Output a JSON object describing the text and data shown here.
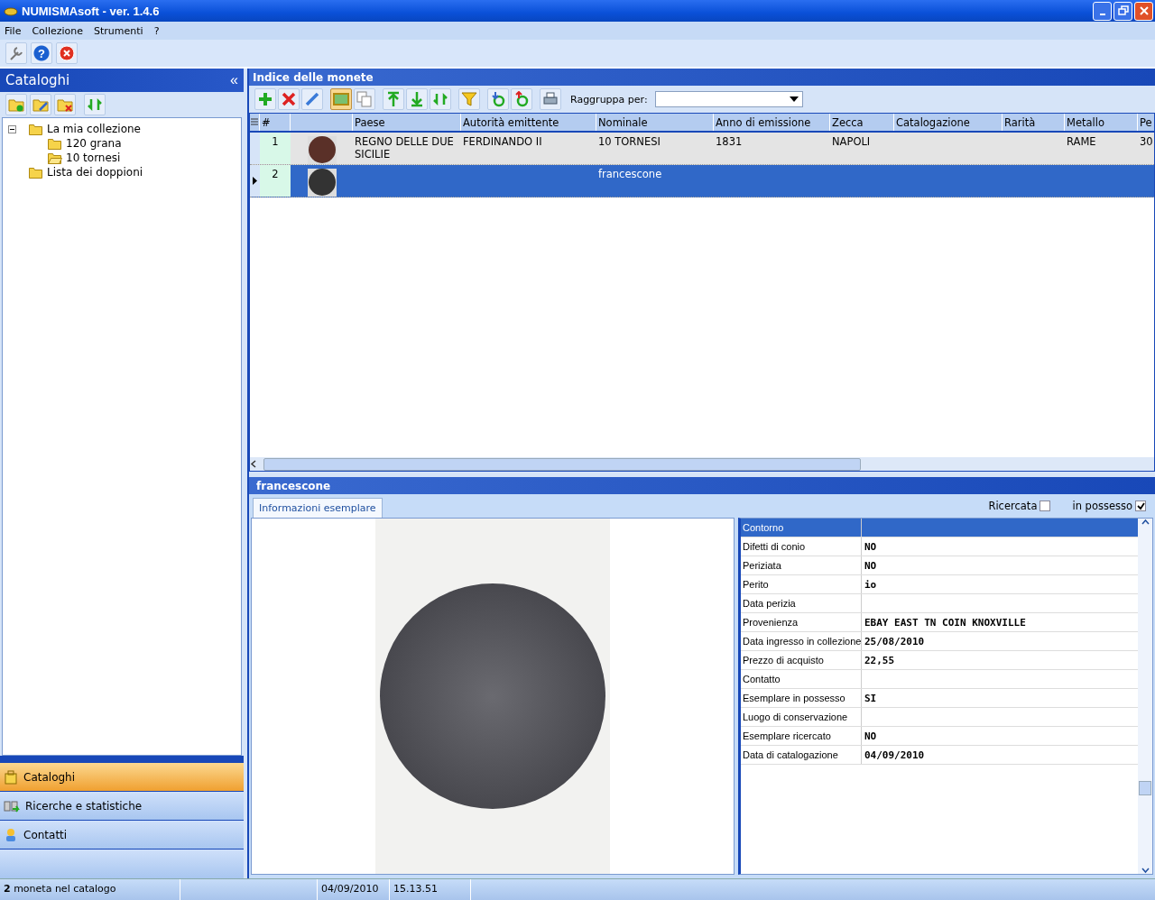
{
  "window": {
    "title": "NUMISMAsoft - ver. 1.4.6"
  },
  "menu": [
    "File",
    "Collezione",
    "Strumenti",
    "?"
  ],
  "main_toolbar": {
    "help_glyph": "?"
  },
  "left_panel": {
    "title": "Cataloghi",
    "collapse": "«",
    "tree": [
      {
        "label": "La mia collezione",
        "open": false,
        "children": [
          {
            "label": "120 grana",
            "open": false
          },
          {
            "label": "10 tornesi",
            "open": true
          }
        ]
      },
      {
        "label": "Lista dei doppioni",
        "open": false
      }
    ],
    "nav": [
      {
        "label": "Cataloghi",
        "selected": true
      },
      {
        "label": "Ricerche e statistiche",
        "selected": false
      },
      {
        "label": "Contatti",
        "selected": false
      }
    ]
  },
  "index_panel": {
    "title": "Indice delle monete",
    "thumbnails_on": true,
    "group_by_label": "Raggruppa per:",
    "columns": [
      "#",
      "Paese",
      "Autorità emittente",
      "Nominale",
      "Anno di emissione",
      "Zecca",
      "Catalogazione",
      "Rarità",
      "Metallo",
      "Pe"
    ],
    "rows": [
      {
        "selected": false,
        "cells": [
          "1",
          "REGNO DELLE DUE SICILIE",
          "FERDINANDO II",
          "10 TORNESI",
          "1831",
          "NAPOLI",
          null,
          null,
          "RAME",
          "30"
        ]
      },
      {
        "selected": true,
        "cells": [
          "2",
          null,
          null,
          "francescone",
          null,
          null,
          null,
          null,
          null,
          null
        ]
      }
    ]
  },
  "detail_panel": {
    "title": "francescone",
    "tabs": [
      {
        "label": "Informazioni esemplare",
        "selected": true
      }
    ],
    "checkboxes": [
      {
        "label": "Ricercata",
        "checked": false
      },
      {
        "label": "in possesso",
        "checked": true
      }
    ],
    "properties": [
      {
        "name": "Contorno",
        "selected": true
      },
      {
        "name": "Difetti di conio",
        "value": "NO",
        "selected": false
      },
      {
        "name": "Periziata",
        "value": "NO",
        "selected": false
      },
      {
        "name": "Perito",
        "value": "io",
        "selected": false
      },
      {
        "name": "Data perizia",
        "selected": false
      },
      {
        "name": "Provenienza",
        "value": "EBAY EAST TN COIN KNOXVILLE",
        "selected": false
      },
      {
        "name": "Data ingresso in collezione",
        "value": "25/08/2010",
        "selected": false
      },
      {
        "name": "Prezzo di acquisto",
        "value": "22,55",
        "selected": false
      },
      {
        "name": "Contatto",
        "selected": false
      },
      {
        "name": "Esemplare in possesso",
        "value": "SI",
        "selected": false
      },
      {
        "name": "Luogo di conservazione",
        "selected": false
      },
      {
        "name": "Esemplare ricercato",
        "value": "NO",
        "selected": false
      },
      {
        "name": "Data di catalogazione",
        "value": "04/09/2010",
        "selected": false
      }
    ]
  },
  "status_bar": {
    "count": "**2** moneta nel catalogo",
    "date": "04/09/2010",
    "time": "15.13.51"
  }
}
